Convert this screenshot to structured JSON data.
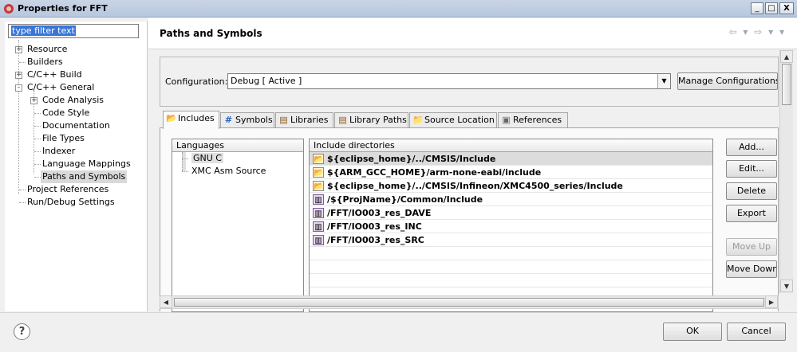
{
  "window": {
    "title": "Properties for FFT",
    "minimize_glyph": "_",
    "maximize_glyph": "□",
    "close_glyph": "X"
  },
  "filter": {
    "value": "type filter text"
  },
  "tree": {
    "items": [
      {
        "label": "Resource",
        "expander": "+"
      },
      {
        "label": "Builders",
        "expander": ""
      },
      {
        "label": "C/C++ Build",
        "expander": "+"
      },
      {
        "label": "C/C++ General",
        "expander": "-"
      },
      {
        "label": "Code Analysis",
        "expander": "+"
      },
      {
        "label": "Code Style",
        "expander": ""
      },
      {
        "label": "Documentation",
        "expander": ""
      },
      {
        "label": "File Types",
        "expander": ""
      },
      {
        "label": "Indexer",
        "expander": ""
      },
      {
        "label": "Language Mappings",
        "expander": ""
      },
      {
        "label": "Paths and Symbols",
        "expander": "",
        "selected": true
      },
      {
        "label": "Project References",
        "expander": ""
      },
      {
        "label": "Run/Debug Settings",
        "expander": ""
      }
    ]
  },
  "header": {
    "title": "Paths and Symbols",
    "nav_glyphs": "⇦ ▾ ⇨ ▾ ▾"
  },
  "configuration": {
    "label": "Configuration:",
    "value": "Debug  [ Active ]",
    "manage_button": "Manage Configurations..."
  },
  "tabs": [
    {
      "label": "Includes",
      "icon": "includes-icon",
      "glyph": "📂",
      "active": true
    },
    {
      "label": "Symbols",
      "icon": "symbols-icon",
      "glyph": "#"
    },
    {
      "label": "Libraries",
      "icon": "libraries-icon",
      "glyph": "▤"
    },
    {
      "label": "Library Paths",
      "icon": "library-paths-icon",
      "glyph": "▤"
    },
    {
      "label": "Source Location",
      "icon": "source-location-icon",
      "glyph": "📁"
    },
    {
      "label": "References",
      "icon": "references-icon",
      "glyph": "▣"
    }
  ],
  "languages": {
    "header": "Languages",
    "items": [
      {
        "label": "GNU C",
        "selected": true
      },
      {
        "label": "XMC Asm Source"
      }
    ]
  },
  "includes": {
    "header": "Include directories",
    "items": [
      {
        "path": "${eclipse_home}/../CMSIS/Include",
        "type": "folder",
        "selected": true
      },
      {
        "path": "${ARM_GCC_HOME}/arm-none-eabi/include",
        "type": "folder"
      },
      {
        "path": "${eclipse_home}/../CMSIS/Infineon/XMC4500_series/Include",
        "type": "folder"
      },
      {
        "path": "/${ProjName}/Common/Include",
        "type": "workspace"
      },
      {
        "path": "/FFT/IO003_res_DAVE",
        "type": "workspace"
      },
      {
        "path": "/FFT/IO003_res_INC",
        "type": "workspace"
      },
      {
        "path": "/FFT/IO003_res_SRC",
        "type": "workspace"
      }
    ]
  },
  "side_buttons": {
    "add": "Add...",
    "edit": "Edit...",
    "delete": "Delete",
    "export": "Export",
    "move_up": "Move Up",
    "move_down": "Move Down"
  },
  "footer": {
    "ok": "OK",
    "cancel": "Cancel",
    "help_glyph": "?"
  },
  "colors": {
    "selection": "#3875d7",
    "title_bar": "#c9d5e6"
  }
}
